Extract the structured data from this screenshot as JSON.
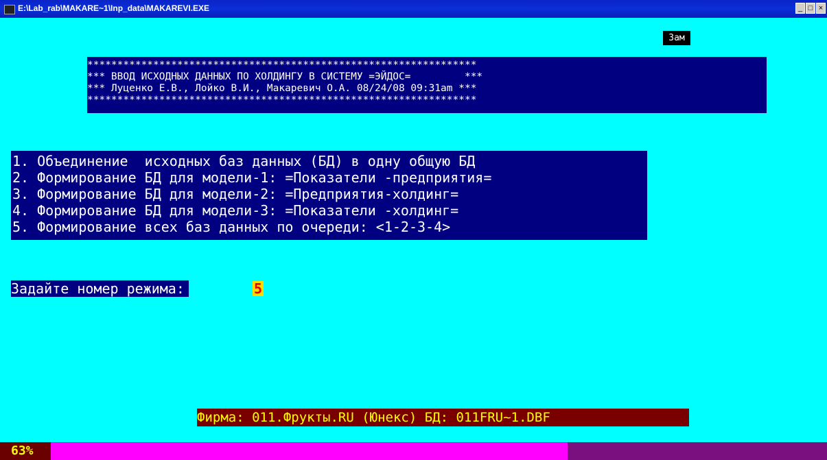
{
  "window": {
    "title": "E:\\Lab_rab\\MAKARE~1\\Inp_data\\MAKAREVI.EXE",
    "controls": [
      "_",
      "□",
      "×"
    ]
  },
  "mode_indicator": "Зам",
  "header": {
    "lines": [
      "*****************************************************************",
      "*** ВВОД ИСХОДНЫХ ДАННЫХ ПО ХОЛДИНГУ В СИСТЕМУ =ЭЙДОС=         ***",
      "*** Луценко Е.В., Лойко В.И., Макаревич О.А. 08/24/08 09:31am ***",
      "*****************************************************************"
    ]
  },
  "menu": {
    "items": [
      "1. Объединение  исходных баз данных (БД) в одну общую БД",
      "2. Формирование БД для модели-1: =Показатели -предприятия=",
      "3. Формирование БД для модели-2: =Предприятия-холдинг=",
      "4. Формирование БД для модели-3: =Показатели -холдинг=",
      "5. Формирование всех баз данных по очереди: <1-2-3-4>"
    ]
  },
  "prompt": {
    "label": "Задайте номер режима:",
    "value": "5"
  },
  "status": {
    "firm": "Фирма: 011.Фрукты.RU (Юнекс) БД: 011FRU~1.DBF"
  },
  "progress": {
    "label": "63%",
    "percent": 63
  },
  "colors": {
    "console_bg": "#00ffff",
    "panel_bg": "#000080",
    "highlight": "#ffd800",
    "progress_fill": "#ff00ff"
  }
}
